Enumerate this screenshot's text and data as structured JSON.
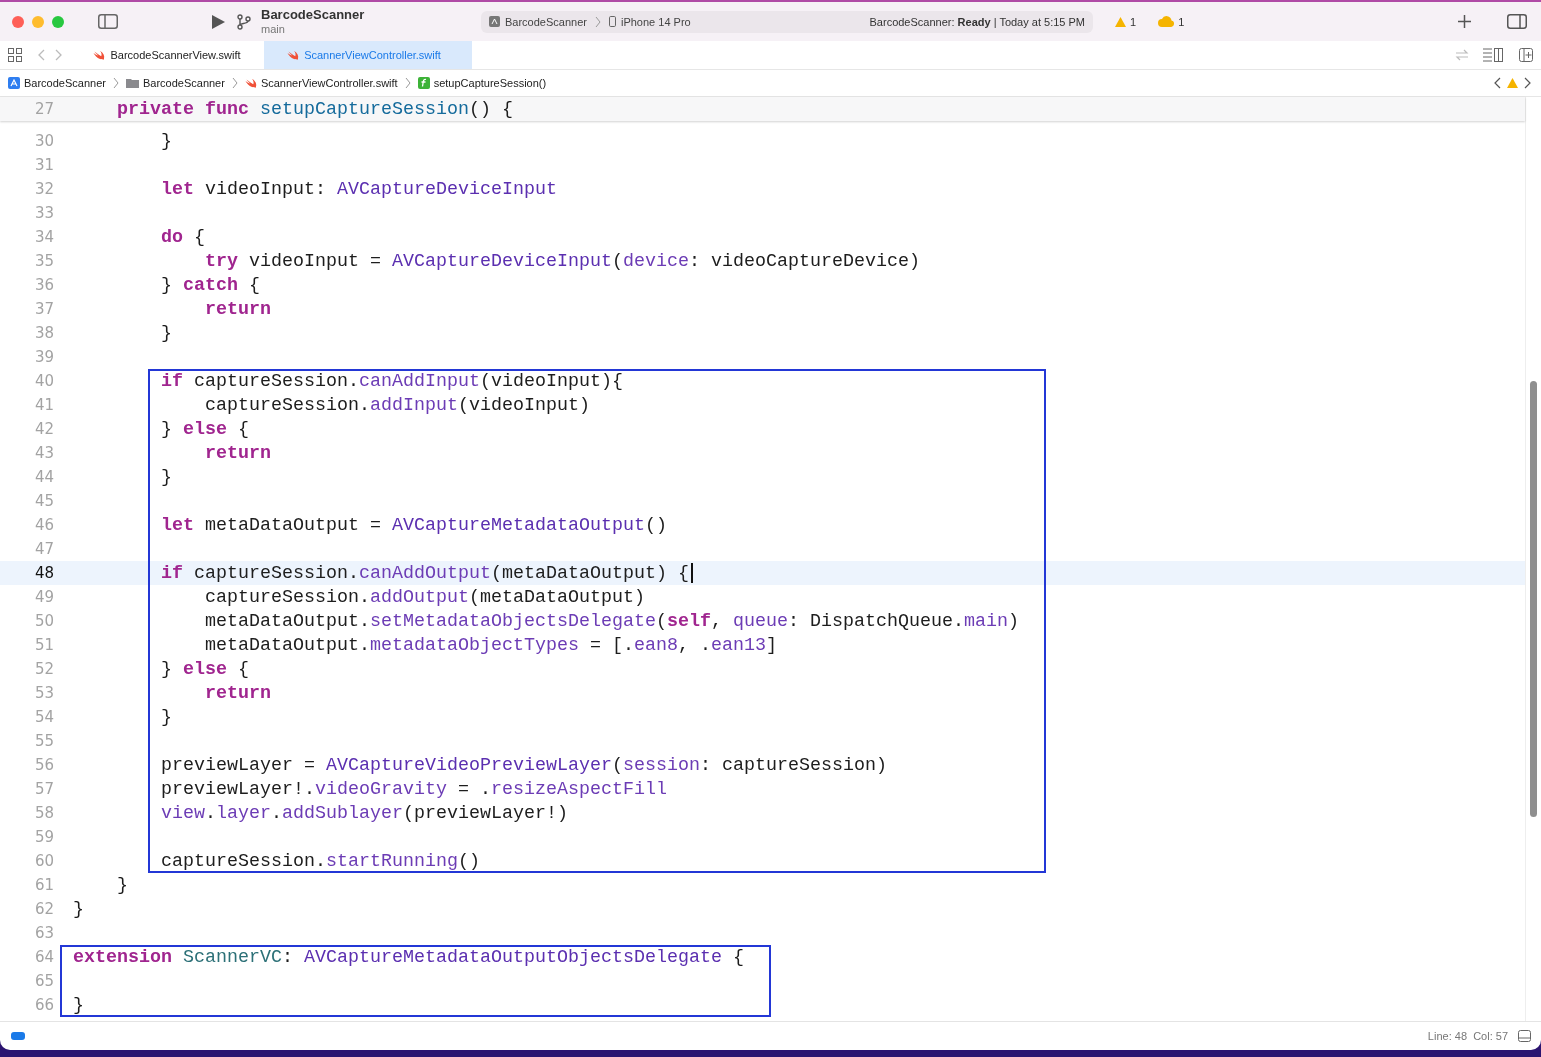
{
  "window": {
    "project": "BarcodeScanner",
    "branch": "main",
    "scheme": {
      "target": "BarcodeScanner",
      "device": "iPhone 14 Pro"
    },
    "status": "BarcodeScanner: **Ready** | Today at 5:15 PM",
    "issues": [
      {
        "kind": "warning",
        "count": "1"
      },
      {
        "kind": "cloud",
        "count": "1"
      }
    ]
  },
  "tabs": [
    {
      "label": "BarcodeScannerView.swift",
      "selected": false
    },
    {
      "label": "ScannerViewController.swift",
      "selected": true
    }
  ],
  "breadcrumb": [
    {
      "kind": "project",
      "label": "BarcodeScanner"
    },
    {
      "kind": "folder",
      "label": "BarcodeScanner"
    },
    {
      "kind": "swift",
      "label": "ScannerViewController.swift"
    },
    {
      "kind": "function",
      "label": "setupCaptureSession()"
    }
  ],
  "editor": {
    "sticky_line": {
      "number": "27",
      "tokens": [
        {
          "kind": "keyword",
          "text": "    private "
        },
        {
          "kind": "keyword",
          "text": "func "
        },
        {
          "kind": "function",
          "text": "setupCaptureSession"
        },
        {
          "kind": "plain",
          "text": "() {"
        }
      ]
    },
    "lines": [
      {
        "number": "30",
        "current": false,
        "boxed": false,
        "tokens": [
          {
            "kind": "plain",
            "text": "        }"
          }
        ]
      },
      {
        "number": "31",
        "current": false,
        "boxed": false
      },
      {
        "number": "32",
        "current": false,
        "boxed": false,
        "tokens": [
          {
            "kind": "keyword",
            "text": "        let"
          },
          {
            "kind": "plain",
            "text": " videoInput: "
          },
          {
            "kind": "type",
            "text": "AVCaptureDeviceInput"
          }
        ]
      },
      {
        "number": "33",
        "current": false,
        "boxed": false
      },
      {
        "number": "34",
        "current": false,
        "boxed": false,
        "tokens": [
          {
            "kind": "keyword",
            "text": "        do"
          },
          {
            "kind": "plain",
            "text": " {"
          }
        ]
      },
      {
        "number": "35",
        "current": false,
        "boxed": false,
        "tokens": [
          {
            "kind": "keyword",
            "text": "            try"
          },
          {
            "kind": "plain",
            "text": " videoInput = "
          },
          {
            "kind": "type",
            "text": "AVCaptureDeviceInput"
          },
          {
            "kind": "plain",
            "text": "("
          },
          {
            "kind": "member",
            "text": "device"
          },
          {
            "kind": "plain",
            "text": ": videoCaptureDevice)"
          }
        ]
      },
      {
        "number": "36",
        "current": false,
        "boxed": false,
        "tokens": [
          {
            "kind": "plain",
            "text": "        } "
          },
          {
            "kind": "keyword",
            "text": "catch"
          },
          {
            "kind": "plain",
            "text": " {"
          }
        ]
      },
      {
        "number": "37",
        "current": false,
        "boxed": false,
        "tokens": [
          {
            "kind": "keyword",
            "text": "            return"
          }
        ]
      },
      {
        "number": "38",
        "current": false,
        "boxed": false,
        "tokens": [
          {
            "kind": "plain",
            "text": "        }"
          }
        ]
      },
      {
        "number": "39",
        "current": false,
        "boxed": false
      },
      {
        "number": "40",
        "current": false,
        "boxed": true,
        "tokens": [
          {
            "kind": "keyword",
            "text": "        if"
          },
          {
            "kind": "plain",
            "text": " captureSession."
          },
          {
            "kind": "member",
            "text": "canAddInput"
          },
          {
            "kind": "plain",
            "text": "(videoInput){"
          }
        ]
      },
      {
        "number": "41",
        "current": false,
        "boxed": true,
        "tokens": [
          {
            "kind": "plain",
            "text": "            captureSession."
          },
          {
            "kind": "member",
            "text": "addInput"
          },
          {
            "kind": "plain",
            "text": "(videoInput)"
          }
        ]
      },
      {
        "number": "42",
        "current": false,
        "boxed": true,
        "tokens": [
          {
            "kind": "plain",
            "text": "        } "
          },
          {
            "kind": "keyword",
            "text": "else"
          },
          {
            "kind": "plain",
            "text": " {"
          }
        ]
      },
      {
        "number": "43",
        "current": false,
        "boxed": true,
        "tokens": [
          {
            "kind": "keyword",
            "text": "            return"
          }
        ]
      },
      {
        "number": "44",
        "current": false,
        "boxed": true,
        "tokens": [
          {
            "kind": "plain",
            "text": "        }"
          }
        ]
      },
      {
        "number": "45",
        "current": false,
        "boxed": true
      },
      {
        "number": "46",
        "current": false,
        "boxed": true,
        "tokens": [
          {
            "kind": "keyword",
            "text": "        let"
          },
          {
            "kind": "plain",
            "text": " metaDataOutput = "
          },
          {
            "kind": "type",
            "text": "AVCaptureMetadataOutput"
          },
          {
            "kind": "plain",
            "text": "()"
          }
        ]
      },
      {
        "number": "47",
        "current": false,
        "boxed": true
      },
      {
        "number": "48",
        "current": true,
        "boxed": true,
        "tokens": [
          {
            "kind": "keyword",
            "text": "        if"
          },
          {
            "kind": "plain",
            "text": " captureSession."
          },
          {
            "kind": "member",
            "text": "canAddOutput"
          },
          {
            "kind": "plain",
            "text": "(metaDataOutput) {"
          }
        ]
      },
      {
        "number": "49",
        "current": false,
        "boxed": true,
        "tokens": [
          {
            "kind": "plain",
            "text": "            captureSession."
          },
          {
            "kind": "member",
            "text": "addOutput"
          },
          {
            "kind": "plain",
            "text": "(metaDataOutput)"
          }
        ]
      },
      {
        "number": "50",
        "current": false,
        "boxed": true,
        "tokens": [
          {
            "kind": "plain",
            "text": "            metaDataOutput."
          },
          {
            "kind": "member",
            "text": "setMetadataObjectsDelegate"
          },
          {
            "kind": "plain",
            "text": "("
          },
          {
            "kind": "keyword",
            "text": "self"
          },
          {
            "kind": "plain",
            "text": ", "
          },
          {
            "kind": "member",
            "text": "queue"
          },
          {
            "kind": "plain",
            "text": ": DispatchQueue."
          },
          {
            "kind": "member",
            "text": "main"
          },
          {
            "kind": "plain",
            "text": ")"
          }
        ]
      },
      {
        "number": "51",
        "current": false,
        "boxed": true,
        "tokens": [
          {
            "kind": "plain",
            "text": "            metaDataOutput."
          },
          {
            "kind": "member",
            "text": "metadataObjectTypes"
          },
          {
            "kind": "plain",
            "text": " = [."
          },
          {
            "kind": "member",
            "text": "ean8"
          },
          {
            "kind": "plain",
            "text": ", ."
          },
          {
            "kind": "member",
            "text": "ean13"
          },
          {
            "kind": "plain",
            "text": "]"
          }
        ]
      },
      {
        "number": "52",
        "current": false,
        "boxed": true,
        "tokens": [
          {
            "kind": "plain",
            "text": "        } "
          },
          {
            "kind": "keyword",
            "text": "else"
          },
          {
            "kind": "plain",
            "text": " {"
          }
        ]
      },
      {
        "number": "53",
        "current": false,
        "boxed": true,
        "tokens": [
          {
            "kind": "keyword",
            "text": "            return"
          }
        ]
      },
      {
        "number": "54",
        "current": false,
        "boxed": true,
        "tokens": [
          {
            "kind": "plain",
            "text": "        }"
          }
        ]
      },
      {
        "number": "55",
        "current": false,
        "boxed": true
      },
      {
        "number": "56",
        "current": false,
        "boxed": true,
        "tokens": [
          {
            "kind": "plain",
            "text": "        previewLayer = "
          },
          {
            "kind": "type",
            "text": "AVCaptureVideoPreviewLayer"
          },
          {
            "kind": "plain",
            "text": "("
          },
          {
            "kind": "member",
            "text": "session"
          },
          {
            "kind": "plain",
            "text": ": captureSession)"
          }
        ]
      },
      {
        "number": "57",
        "current": false,
        "boxed": true,
        "tokens": [
          {
            "kind": "plain",
            "text": "        previewLayer!."
          },
          {
            "kind": "member",
            "text": "videoGravity"
          },
          {
            "kind": "plain",
            "text": " = ."
          },
          {
            "kind": "member",
            "text": "resizeAspectFill"
          }
        ]
      },
      {
        "number": "58",
        "current": false,
        "boxed": true,
        "tokens": [
          {
            "kind": "member",
            "text": "        view"
          },
          {
            "kind": "plain",
            "text": "."
          },
          {
            "kind": "member",
            "text": "layer"
          },
          {
            "kind": "plain",
            "text": "."
          },
          {
            "kind": "member",
            "text": "addSublayer"
          },
          {
            "kind": "plain",
            "text": "(previewLayer!)"
          }
        ]
      },
      {
        "number": "59",
        "current": false,
        "boxed": true
      },
      {
        "number": "60",
        "current": false,
        "boxed": true,
        "tokens": [
          {
            "kind": "plain",
            "text": "        captureSession."
          },
          {
            "kind": "member",
            "text": "startRunning"
          },
          {
            "kind": "plain",
            "text": "()"
          }
        ]
      },
      {
        "number": "61",
        "current": false,
        "boxed": false,
        "tokens": [
          {
            "kind": "plain",
            "text": "    }"
          }
        ]
      },
      {
        "number": "62",
        "current": false,
        "boxed": false,
        "tokens": [
          {
            "kind": "plain",
            "text": "}"
          }
        ]
      },
      {
        "number": "63",
        "current": false,
        "boxed": false
      },
      {
        "number": "64",
        "current": false,
        "boxed": true,
        "tokens": [
          {
            "kind": "keyword",
            "text": "extension"
          },
          {
            "kind": "custom",
            "text": " ScannerVC"
          },
          {
            "kind": "plain",
            "text": ": "
          },
          {
            "kind": "type",
            "text": "AVCaptureMetadataOutputObjectsDelegate"
          },
          {
            "kind": "plain",
            "text": " {"
          }
        ]
      },
      {
        "number": "65",
        "current": false,
        "boxed": true
      },
      {
        "number": "66",
        "current": false,
        "boxed": true,
        "tokens": [
          {
            "kind": "plain",
            "text": "}"
          }
        ]
      }
    ]
  },
  "status_bar": {
    "debug_area_on": true,
    "line": "Line: 48",
    "col": "Col: 57"
  }
}
